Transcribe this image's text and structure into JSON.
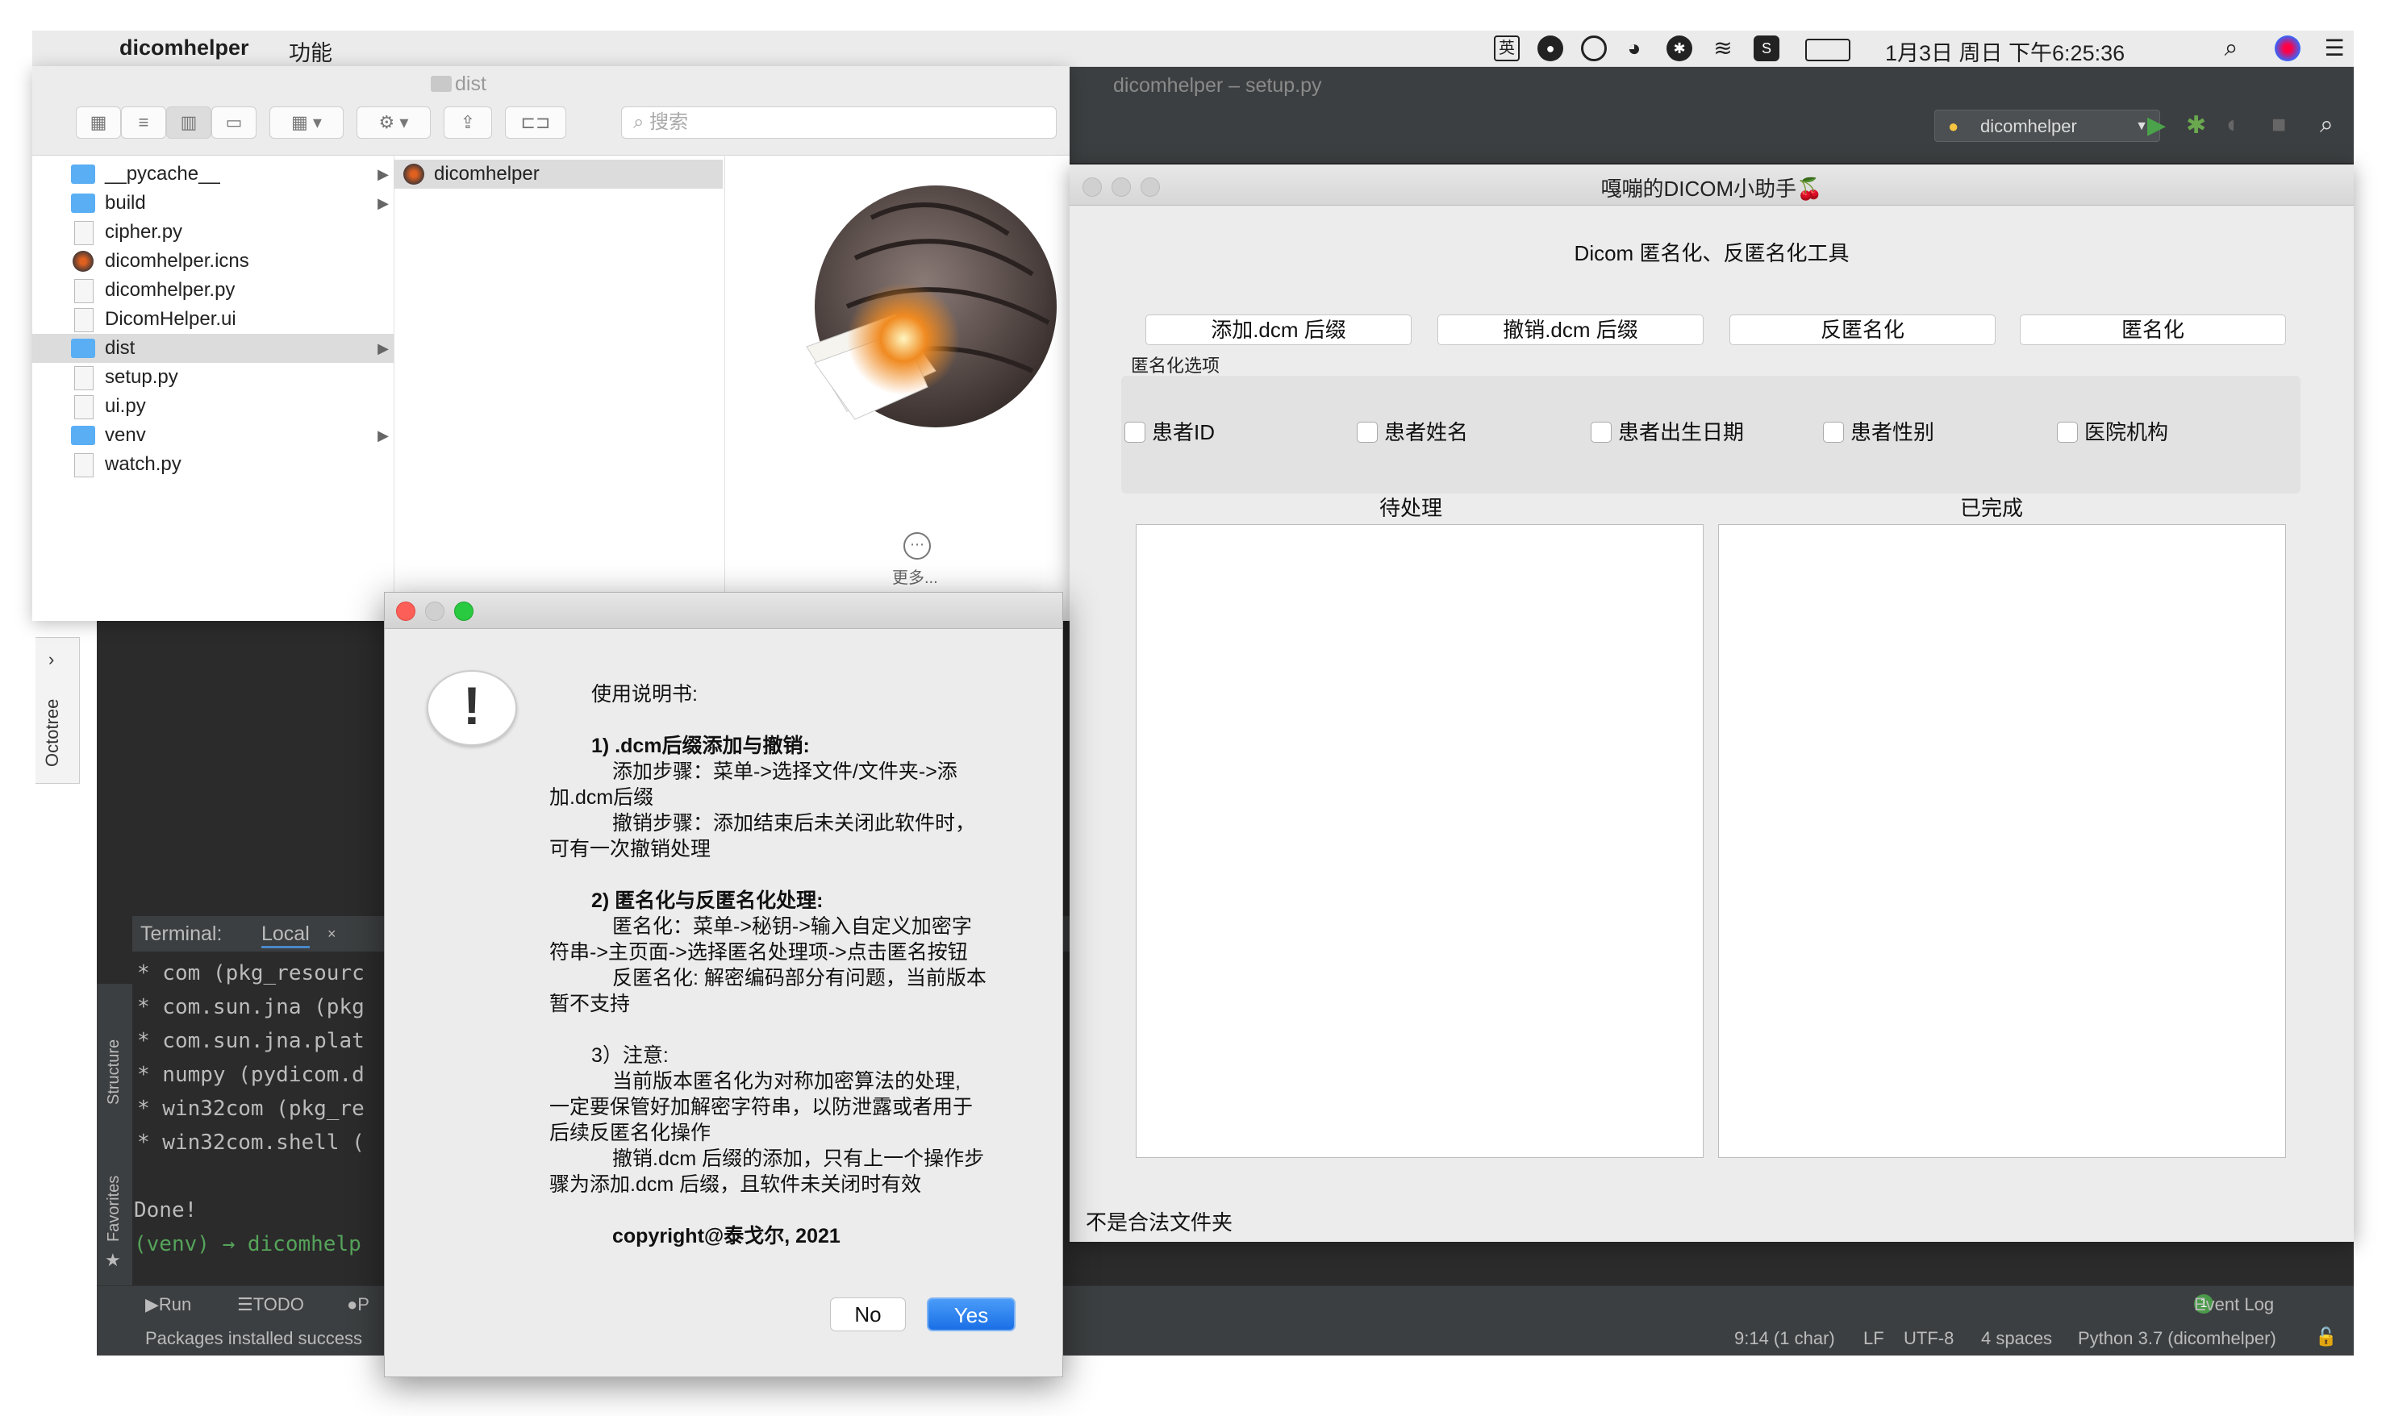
{
  "menubar": {
    "app_name": "dicomhelper",
    "menu_item": "功能",
    "input_method": "英",
    "clock": "1月3日 周日 下午6:25:36"
  },
  "ide": {
    "window_title": "dicomhelper – setup.py",
    "run_config": "dicomhelper",
    "side_octotree": "Octotree",
    "side_structure": "Structure",
    "side_favorites": "Favorites",
    "terminal_label": "Terminal:",
    "terminal_tab": "Local",
    "terminal_lines": [
      "* com (pkg_resourc",
      "* com.sun.jna (pkg",
      "* com.sun.jna.plat",
      "* numpy (pydicom.d",
      "* win32com (pkg_re",
      "* win32com.shell (",
      "",
      "Done!",
      "(venv) → dicomhelp"
    ],
    "bottom_tabs": [
      "Run",
      "TODO",
      "P"
    ],
    "event_log": "Event Log",
    "event_count": "1",
    "status_left": "Packages installed success",
    "status_items": [
      "9:14 (1 char)",
      "LF",
      "UTF-8",
      "4 spaces",
      "Python 3.7 (dicomhelper)"
    ]
  },
  "finder": {
    "title": "dist",
    "search_placeholder": "搜索",
    "items": [
      {
        "name": "__pycache__",
        "kind": "folder"
      },
      {
        "name": "build",
        "kind": "folder"
      },
      {
        "name": "cipher.py",
        "kind": "file"
      },
      {
        "name": "dicomhelper.icns",
        "kind": "app"
      },
      {
        "name": "dicomhelper.py",
        "kind": "file"
      },
      {
        "name": "DicomHelper.ui",
        "kind": "file"
      },
      {
        "name": "dist",
        "kind": "folder"
      },
      {
        "name": "setup.py",
        "kind": "file"
      },
      {
        "name": "ui.py",
        "kind": "file"
      },
      {
        "name": "venv",
        "kind": "folder"
      },
      {
        "name": "watch.py",
        "kind": "file"
      }
    ],
    "selected_item": "dist",
    "column2_item": "dicomhelper",
    "more_label": "更多..."
  },
  "app": {
    "title": "嘎嘣的DICOM小助手🍒",
    "heading": "Dicom 匿名化、反匿名化工具",
    "buttons": [
      "添加.dcm 后缀",
      "撤销.dcm 后缀",
      "反匿名化",
      "匿名化"
    ],
    "options_label": "匿名化选项",
    "checkboxes": [
      "患者ID",
      "患者姓名",
      "患者出生日期",
      "患者性别",
      "医院机构"
    ],
    "pending_label": "待处理",
    "done_label": "已完成",
    "status": "不是合法文件夹"
  },
  "dialog": {
    "lines": [
      "使用说明书:",
      "1) .dcm后缀添加与撤销:",
      "添加步骤：菜单->选择文件/文件夹->添",
      "加.dcm后缀",
      "撤销步骤：添加结束后未关闭此软件时，",
      "可有一次撤销处理",
      "2) 匿名化与反匿名化处理:",
      "匿名化：菜单->秘钥->输入自定义加密字",
      "符串->主页面->选择匿名处理项->点击匿名按钮",
      "反匿名化: 解密编码部分有问题，当前版本",
      "暂不支持",
      "3）注意:",
      "当前版本匿名化为对称加密算法的处理,",
      "一定要保管好加解密字符串，以防泄露或者用于",
      "后续反匿名化操作",
      "撤销.dcm 后缀的添加，只有上一个操作步",
      "骤为添加.dcm 后缀，且软件未关闭时有效",
      "copyright@泰戈尔, 2021"
    ],
    "no_label": "No",
    "yes_label": "Yes"
  }
}
